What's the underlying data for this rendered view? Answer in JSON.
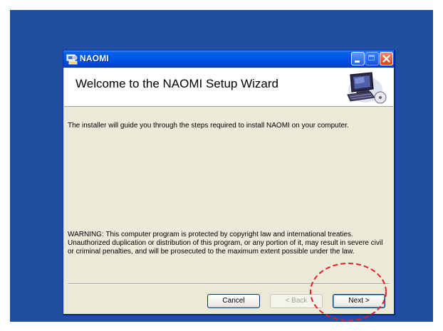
{
  "window": {
    "title": "NAOMI",
    "icon": "installer-app-icon",
    "controls": [
      "minimize-icon",
      "maximize-icon",
      "close-icon"
    ]
  },
  "header": {
    "title": "Welcome to the NAOMI Setup Wizard",
    "graphic": "computer-cd-icon"
  },
  "body": {
    "intro": "The installer will guide you through the steps required to install NAOMI on your computer.",
    "warning_lines": [
      "WARNING: This computer program is protected by copyright law and international treaties.",
      "Unauthorized duplication or distribution of this program, or any portion of it, may result in severe civil",
      "or criminal penalties, and will be prosecuted to the maximum extent possible under the law."
    ]
  },
  "buttons": {
    "cancel": "Cancel",
    "back": "< Back",
    "next": "Next >"
  },
  "colors": {
    "desktop": "#1f4f9e",
    "titlebar": "#0055e5",
    "dialog": "#ece9d8",
    "highlight": "#e31e24"
  },
  "annotation": {
    "highlighted_control": "next-button"
  }
}
